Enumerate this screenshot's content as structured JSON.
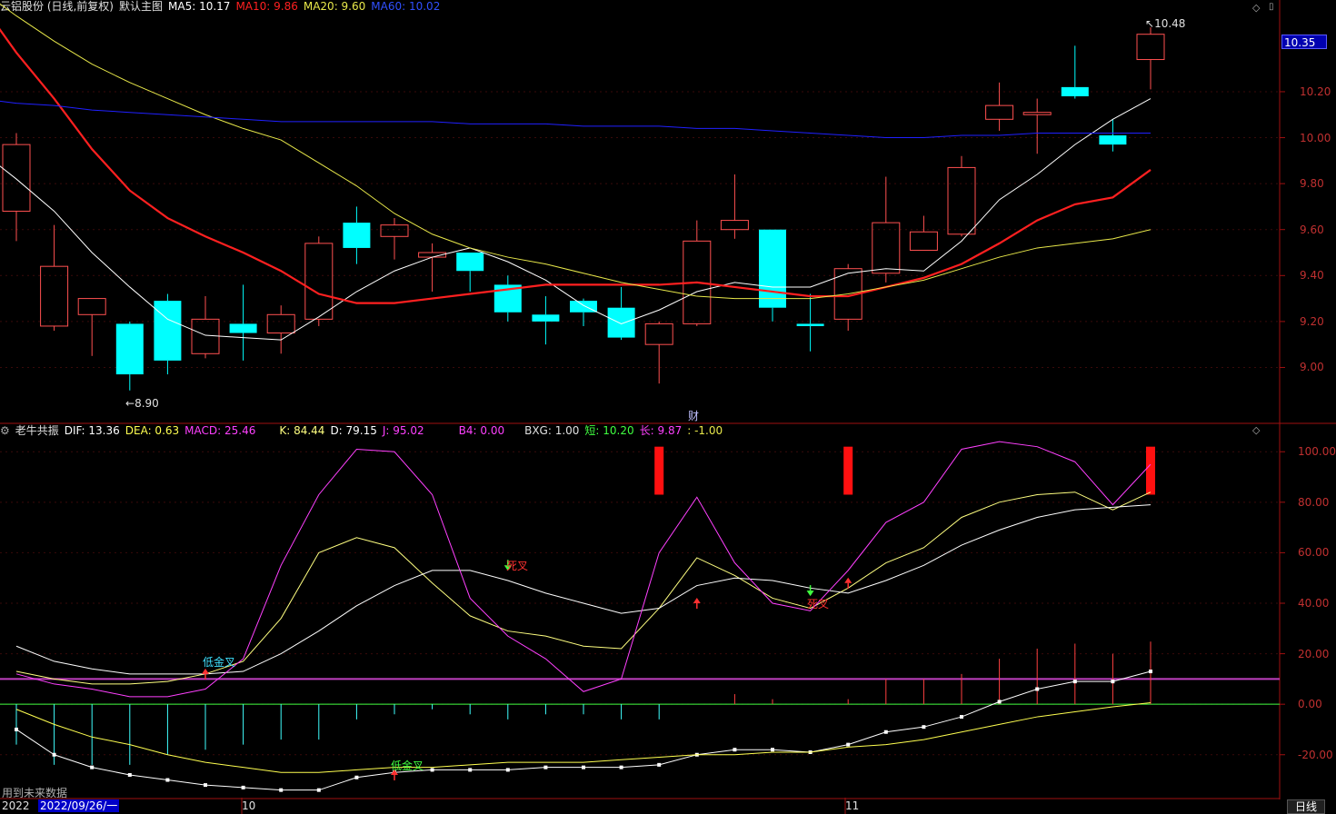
{
  "main_header": {
    "title": "云铝股份 (日线,前复权)",
    "main_label": "默认主图",
    "ma5": "MA5: 10.17",
    "ma10": "MA10: 9.86",
    "ma20": "MA20: 9.60",
    "ma60": "MA60: 10.02"
  },
  "indicator_header": {
    "title": "老牛共振",
    "dif": "DIF: 13.36",
    "dea": "DEA: 0.63",
    "macd": "MACD: 25.46",
    "k": "K: 84.44",
    "d": "D: 79.15",
    "j": "J: 95.02",
    "b4": "B4: 0.00",
    "bxg": "BXG: 1.00",
    "short": "短: 10.20",
    "long": "长: 9.87",
    "extra": ": -1.00"
  },
  "price_axis": {
    "current_price": "10.35",
    "ticks": [
      "10.20",
      "10.00",
      "9.80",
      "9.60",
      "9.40",
      "9.20",
      "9.00"
    ]
  },
  "indicator_axis": {
    "ticks": [
      "100.00",
      "80.00",
      "60.00",
      "40.00",
      "20.00",
      "0.00",
      "-20.00"
    ]
  },
  "annotations": {
    "high": "10.48",
    "low": "8.90",
    "finance": "财",
    "dead_cross_1": "死叉",
    "dead_cross_2": "死叉",
    "low_gold_cross_1": "低金叉",
    "low_gold_cross_2": "低金叉"
  },
  "footer": {
    "note": "用到未来数据",
    "date": "2022/09/26/一",
    "year_prefix": "2022",
    "month_10": "10",
    "month_11": "11",
    "period": "日线"
  },
  "colors": {
    "up": "#ff5050",
    "down": "#00ffff",
    "ma5": "#ffffff",
    "ma10": "#ff2020",
    "ma20": "#e8e84a",
    "ma60": "#2020ff",
    "k": "#ffff80",
    "d": "#ffffff",
    "j": "#ff40ff"
  },
  "chart_data": [
    {
      "type": "candlestick",
      "title": "云铝股份 (日线,前复权)",
      "candles": [
        {
          "open": 9.68,
          "close": 9.97,
          "high": 10.02,
          "low": 9.55
        },
        {
          "open": 9.18,
          "close": 9.44,
          "high": 9.62,
          "low": 9.16
        },
        {
          "open": 9.23,
          "close": 9.3,
          "high": 9.3,
          "low": 9.05
        },
        {
          "open": 9.19,
          "close": 8.97,
          "high": 9.2,
          "low": 8.9
        },
        {
          "open": 9.29,
          "close": 9.03,
          "high": 9.32,
          "low": 8.97
        },
        {
          "open": 9.06,
          "close": 9.21,
          "high": 9.31,
          "low": 9.04
        },
        {
          "open": 9.19,
          "close": 9.15,
          "high": 9.36,
          "low": 9.03
        },
        {
          "open": 9.15,
          "close": 9.23,
          "high": 9.27,
          "low": 9.06
        },
        {
          "open": 9.21,
          "close": 9.54,
          "high": 9.57,
          "low": 9.18
        },
        {
          "open": 9.63,
          "close": 9.52,
          "high": 9.7,
          "low": 9.45
        },
        {
          "open": 9.57,
          "close": 9.62,
          "high": 9.65,
          "low": 9.47
        },
        {
          "open": 9.48,
          "close": 9.5,
          "high": 9.54,
          "low": 9.33
        },
        {
          "open": 9.5,
          "close": 9.42,
          "high": 9.5,
          "low": 9.33
        },
        {
          "open": 9.36,
          "close": 9.24,
          "high": 9.4,
          "low": 9.2
        },
        {
          "open": 9.23,
          "close": 9.2,
          "high": 9.31,
          "low": 9.1
        },
        {
          "open": 9.29,
          "close": 9.24,
          "high": 9.3,
          "low": 9.18
        },
        {
          "open": 9.26,
          "close": 9.13,
          "high": 9.35,
          "low": 9.12
        },
        {
          "open": 9.1,
          "close": 9.19,
          "high": 9.2,
          "low": 8.93
        },
        {
          "open": 9.19,
          "close": 9.55,
          "high": 9.64,
          "low": 9.18
        },
        {
          "open": 9.6,
          "close": 9.64,
          "high": 9.84,
          "low": 9.56
        },
        {
          "open": 9.6,
          "close": 9.26,
          "high": 9.6,
          "low": 9.2
        },
        {
          "open": 9.19,
          "close": 9.18,
          "high": 9.32,
          "low": 9.07
        },
        {
          "open": 9.21,
          "close": 9.43,
          "high": 9.45,
          "low": 9.16
        },
        {
          "open": 9.41,
          "close": 9.63,
          "high": 9.83,
          "low": 9.37
        },
        {
          "open": 9.51,
          "close": 9.59,
          "high": 9.66,
          "low": 9.51
        },
        {
          "open": 9.58,
          "close": 9.87,
          "high": 9.92,
          "low": 9.57
        },
        {
          "open": 10.08,
          "close": 10.14,
          "high": 10.24,
          "low": 10.03
        },
        {
          "open": 10.1,
          "close": 10.11,
          "high": 10.17,
          "low": 9.93
        },
        {
          "open": 10.22,
          "close": 10.18,
          "high": 10.4,
          "low": 10.17
        },
        {
          "open": 10.01,
          "close": 9.97,
          "high": 10.08,
          "low": 9.94
        },
        {
          "open": 10.34,
          "close": 10.45,
          "high": 10.48,
          "low": 10.21
        }
      ],
      "ma": {
        "MA5": [
          9.95,
          9.82,
          9.68,
          9.5,
          9.35,
          9.21,
          9.14,
          9.13,
          9.12,
          9.22,
          9.33,
          9.42,
          9.48,
          9.52,
          9.46,
          9.38,
          9.27,
          9.19,
          9.25,
          9.33,
          9.37,
          9.35,
          9.35,
          9.41,
          9.43,
          9.42,
          9.55,
          9.73,
          9.84,
          9.97,
          10.08,
          10.17
        ],
        "MA10": [
          10.6,
          10.37,
          10.17,
          9.95,
          9.77,
          9.65,
          9.57,
          9.5,
          9.42,
          9.32,
          9.28,
          9.28,
          9.3,
          9.32,
          9.34,
          9.36,
          9.36,
          9.36,
          9.36,
          9.37,
          9.35,
          9.33,
          9.31,
          9.31,
          9.35,
          9.39,
          9.45,
          9.54,
          9.64,
          9.71,
          9.74,
          9.86
        ],
        "MA20": [
          10.65,
          10.53,
          10.42,
          10.32,
          10.24,
          10.17,
          10.1,
          10.04,
          9.99,
          9.89,
          9.79,
          9.67,
          9.58,
          9.52,
          9.48,
          9.45,
          9.41,
          9.37,
          9.34,
          9.31,
          9.3,
          9.3,
          9.3,
          9.32,
          9.35,
          9.38,
          9.43,
          9.48,
          9.52,
          9.54,
          9.56,
          9.6
        ],
        "MA60": [
          10.17,
          10.15,
          10.14,
          10.12,
          10.11,
          10.1,
          10.09,
          10.08,
          10.07,
          10.07,
          10.07,
          10.07,
          10.07,
          10.06,
          10.06,
          10.06,
          10.05,
          10.05,
          10.05,
          10.04,
          10.04,
          10.03,
          10.02,
          10.01,
          10.0,
          10.0,
          10.01,
          10.01,
          10.02,
          10.02,
          10.02,
          10.02
        ]
      },
      "ylim": [
        8.82,
        10.52
      ]
    },
    {
      "type": "line",
      "title": "老牛共振",
      "ylim": [
        -37,
        108
      ],
      "series": [
        {
          "name": "K",
          "values": [
            13,
            10,
            8,
            8,
            9,
            12,
            17,
            34,
            60,
            66,
            62,
            48,
            35,
            29,
            27,
            23,
            22,
            38,
            58,
            51,
            42,
            38,
            46,
            56,
            62,
            74,
            80,
            83,
            84,
            77,
            84
          ]
        },
        {
          "name": "D",
          "values": [
            23,
            17,
            14,
            12,
            12,
            12,
            13,
            20,
            29,
            39,
            47,
            53,
            53,
            49,
            44,
            40,
            36,
            38,
            47,
            50,
            49,
            46,
            44,
            49,
            55,
            63,
            69,
            74,
            77,
            78,
            79
          ]
        },
        {
          "name": "J",
          "values": [
            12,
            8,
            6,
            3,
            3,
            6,
            18,
            55,
            83,
            101,
            100,
            83,
            42,
            27,
            18,
            5,
            10,
            60,
            82,
            56,
            40,
            37,
            53,
            72,
            80,
            101,
            104,
            102,
            96,
            79,
            95
          ]
        },
        {
          "name": "DIF",
          "values": [
            -10,
            -20,
            -25,
            -28,
            -30,
            -32,
            -33,
            -34,
            -34,
            -29,
            -27,
            -26,
            -26,
            -26,
            -25,
            -25,
            -25,
            -24,
            -20,
            -18,
            -18,
            -19,
            -16,
            -11,
            -9,
            -5,
            1,
            6,
            9,
            9,
            13
          ]
        },
        {
          "name": "DEA",
          "values": [
            -2,
            -8,
            -13,
            -16,
            -20,
            -23,
            -25,
            -27,
            -27,
            -26,
            -25,
            -25,
            -24,
            -23,
            -23,
            -23,
            -22,
            -21,
            -20,
            -20,
            -19,
            -19,
            -17,
            -16,
            -14,
            -11,
            -8,
            -5,
            -3,
            -1,
            0.6
          ]
        }
      ]
    }
  ]
}
